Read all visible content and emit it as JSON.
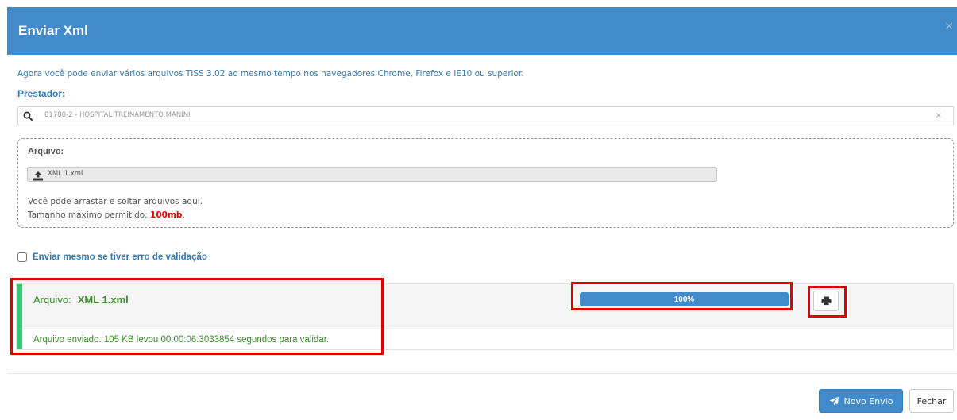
{
  "modal": {
    "title": "Enviar Xml",
    "close_glyph": "×"
  },
  "info_text": "Agora você pode enviar vários arquivos TISS 3.02 ao mesmo tempo nos navegadores Chrome, Firefox e IE10 ou superior.",
  "prestador": {
    "label": "Prestador:",
    "value": "01780-2 - HOSPITAL TREINAMENTO MANINI",
    "clear_glyph": "×",
    "icon": "search-icon"
  },
  "dropzone": {
    "label": "Arquivo:",
    "file_name": "XML 1.xml",
    "hint_drag": "Você pode arrastar e soltar arquivos aqui.",
    "hint_max_prefix": "Tamanho máximo permitido: ",
    "hint_max_value": "100mb",
    "hint_max_suffix": ".",
    "icon": "upload-icon"
  },
  "validation": {
    "label": "Enviar mesmo se tiver erro de validação",
    "checked": false
  },
  "result": {
    "title_label": "Arquivo:",
    "file_name": "XML 1.xml",
    "progress_percent": 100,
    "progress_text": "100%",
    "message": "Arquivo enviado. 105 KB levou 00:00:06.3033854 segundos para validar.",
    "print_icon": "print-icon"
  },
  "footer": {
    "novo_envio_label": "Novo Envio",
    "novo_envio_icon": "paper-plane-icon",
    "fechar_label": "Fechar"
  },
  "colors": {
    "header": "#428bca",
    "link": "#337ab7",
    "success": "#3c8d2f",
    "success_bar": "#2ecc71",
    "highlight": "#e00000"
  }
}
